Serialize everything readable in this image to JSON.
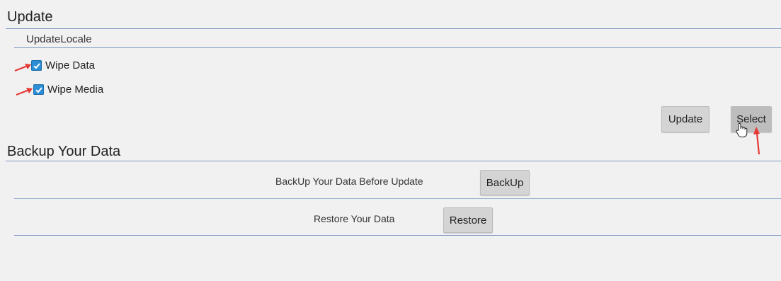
{
  "update_section": {
    "title": "Update",
    "subtitle": "UpdateLocale",
    "checkboxes": [
      {
        "label": "Wipe Data",
        "checked": true
      },
      {
        "label": "Wipe Media",
        "checked": true
      }
    ],
    "update_button": "Update",
    "select_button": "Select"
  },
  "backup_section": {
    "title": "Backup Your Data",
    "rows": [
      {
        "text": "BackUp Your Data Before Update",
        "button": "BackUp"
      },
      {
        "text": "Restore Your Data",
        "button": "Restore"
      }
    ]
  },
  "colors": {
    "divider": "#7e98c2",
    "checkbox": "#2c8ed6",
    "button": "#d4d4d4",
    "annotation_arrow": "#e53935"
  },
  "icons": [
    "check-icon",
    "hand-cursor-icon",
    "red-arrow-icon"
  ]
}
